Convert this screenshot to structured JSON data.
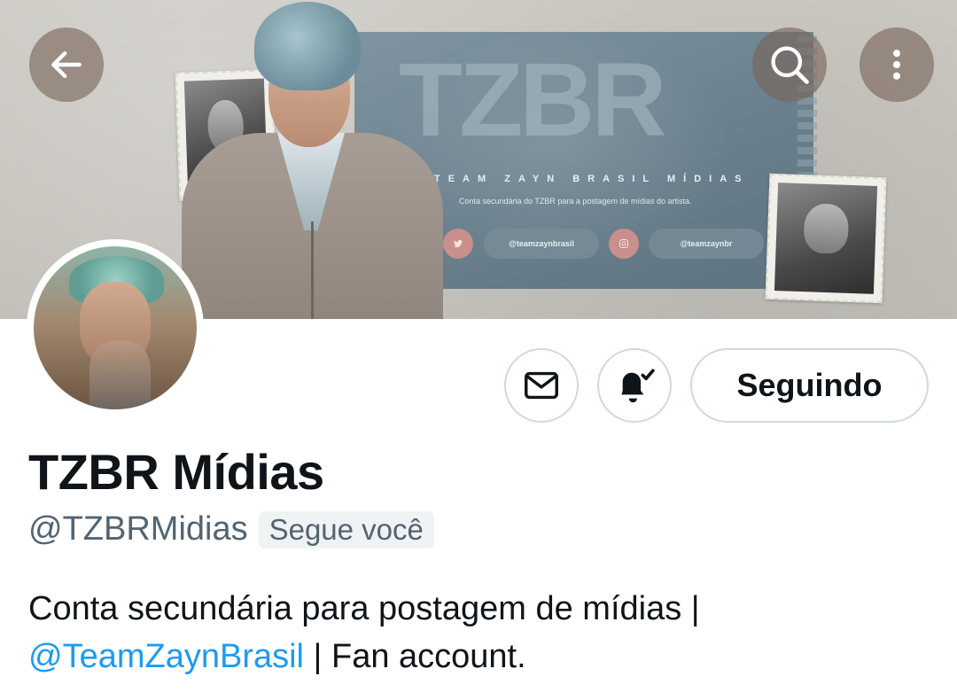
{
  "header": {
    "banner": {
      "logo_text": "TZBR",
      "team_text": "TEAM ZAYN BRASIL MÍDIAS",
      "description": "Conta secundária do TZBR para a postagem de mídias do artista.",
      "twitter_handle": "@teamzaynbrasil",
      "instagram_handle": "@teamzaynbr"
    },
    "nav": {
      "back_icon": "arrow-left-icon",
      "search_icon": "search-icon",
      "more_icon": "more-vertical-icon"
    }
  },
  "actions": {
    "message_icon": "envelope-icon",
    "notify_icon": "bell-check-icon",
    "follow_label": "Seguindo"
  },
  "profile": {
    "display_name": "TZBR Mídias",
    "handle": "@TZBRMidias",
    "follows_you": "Segue você",
    "bio_part1": "Conta secundária para postagem de mídias |",
    "bio_mention": "@TeamZaynBrasil",
    "bio_part2": " | Fan account."
  },
  "colors": {
    "accent": "#1d9bf0",
    "text_primary": "#0f1419",
    "text_secondary": "#536471",
    "border": "#cfd9de",
    "nav_button_bg": "#7a6458"
  }
}
